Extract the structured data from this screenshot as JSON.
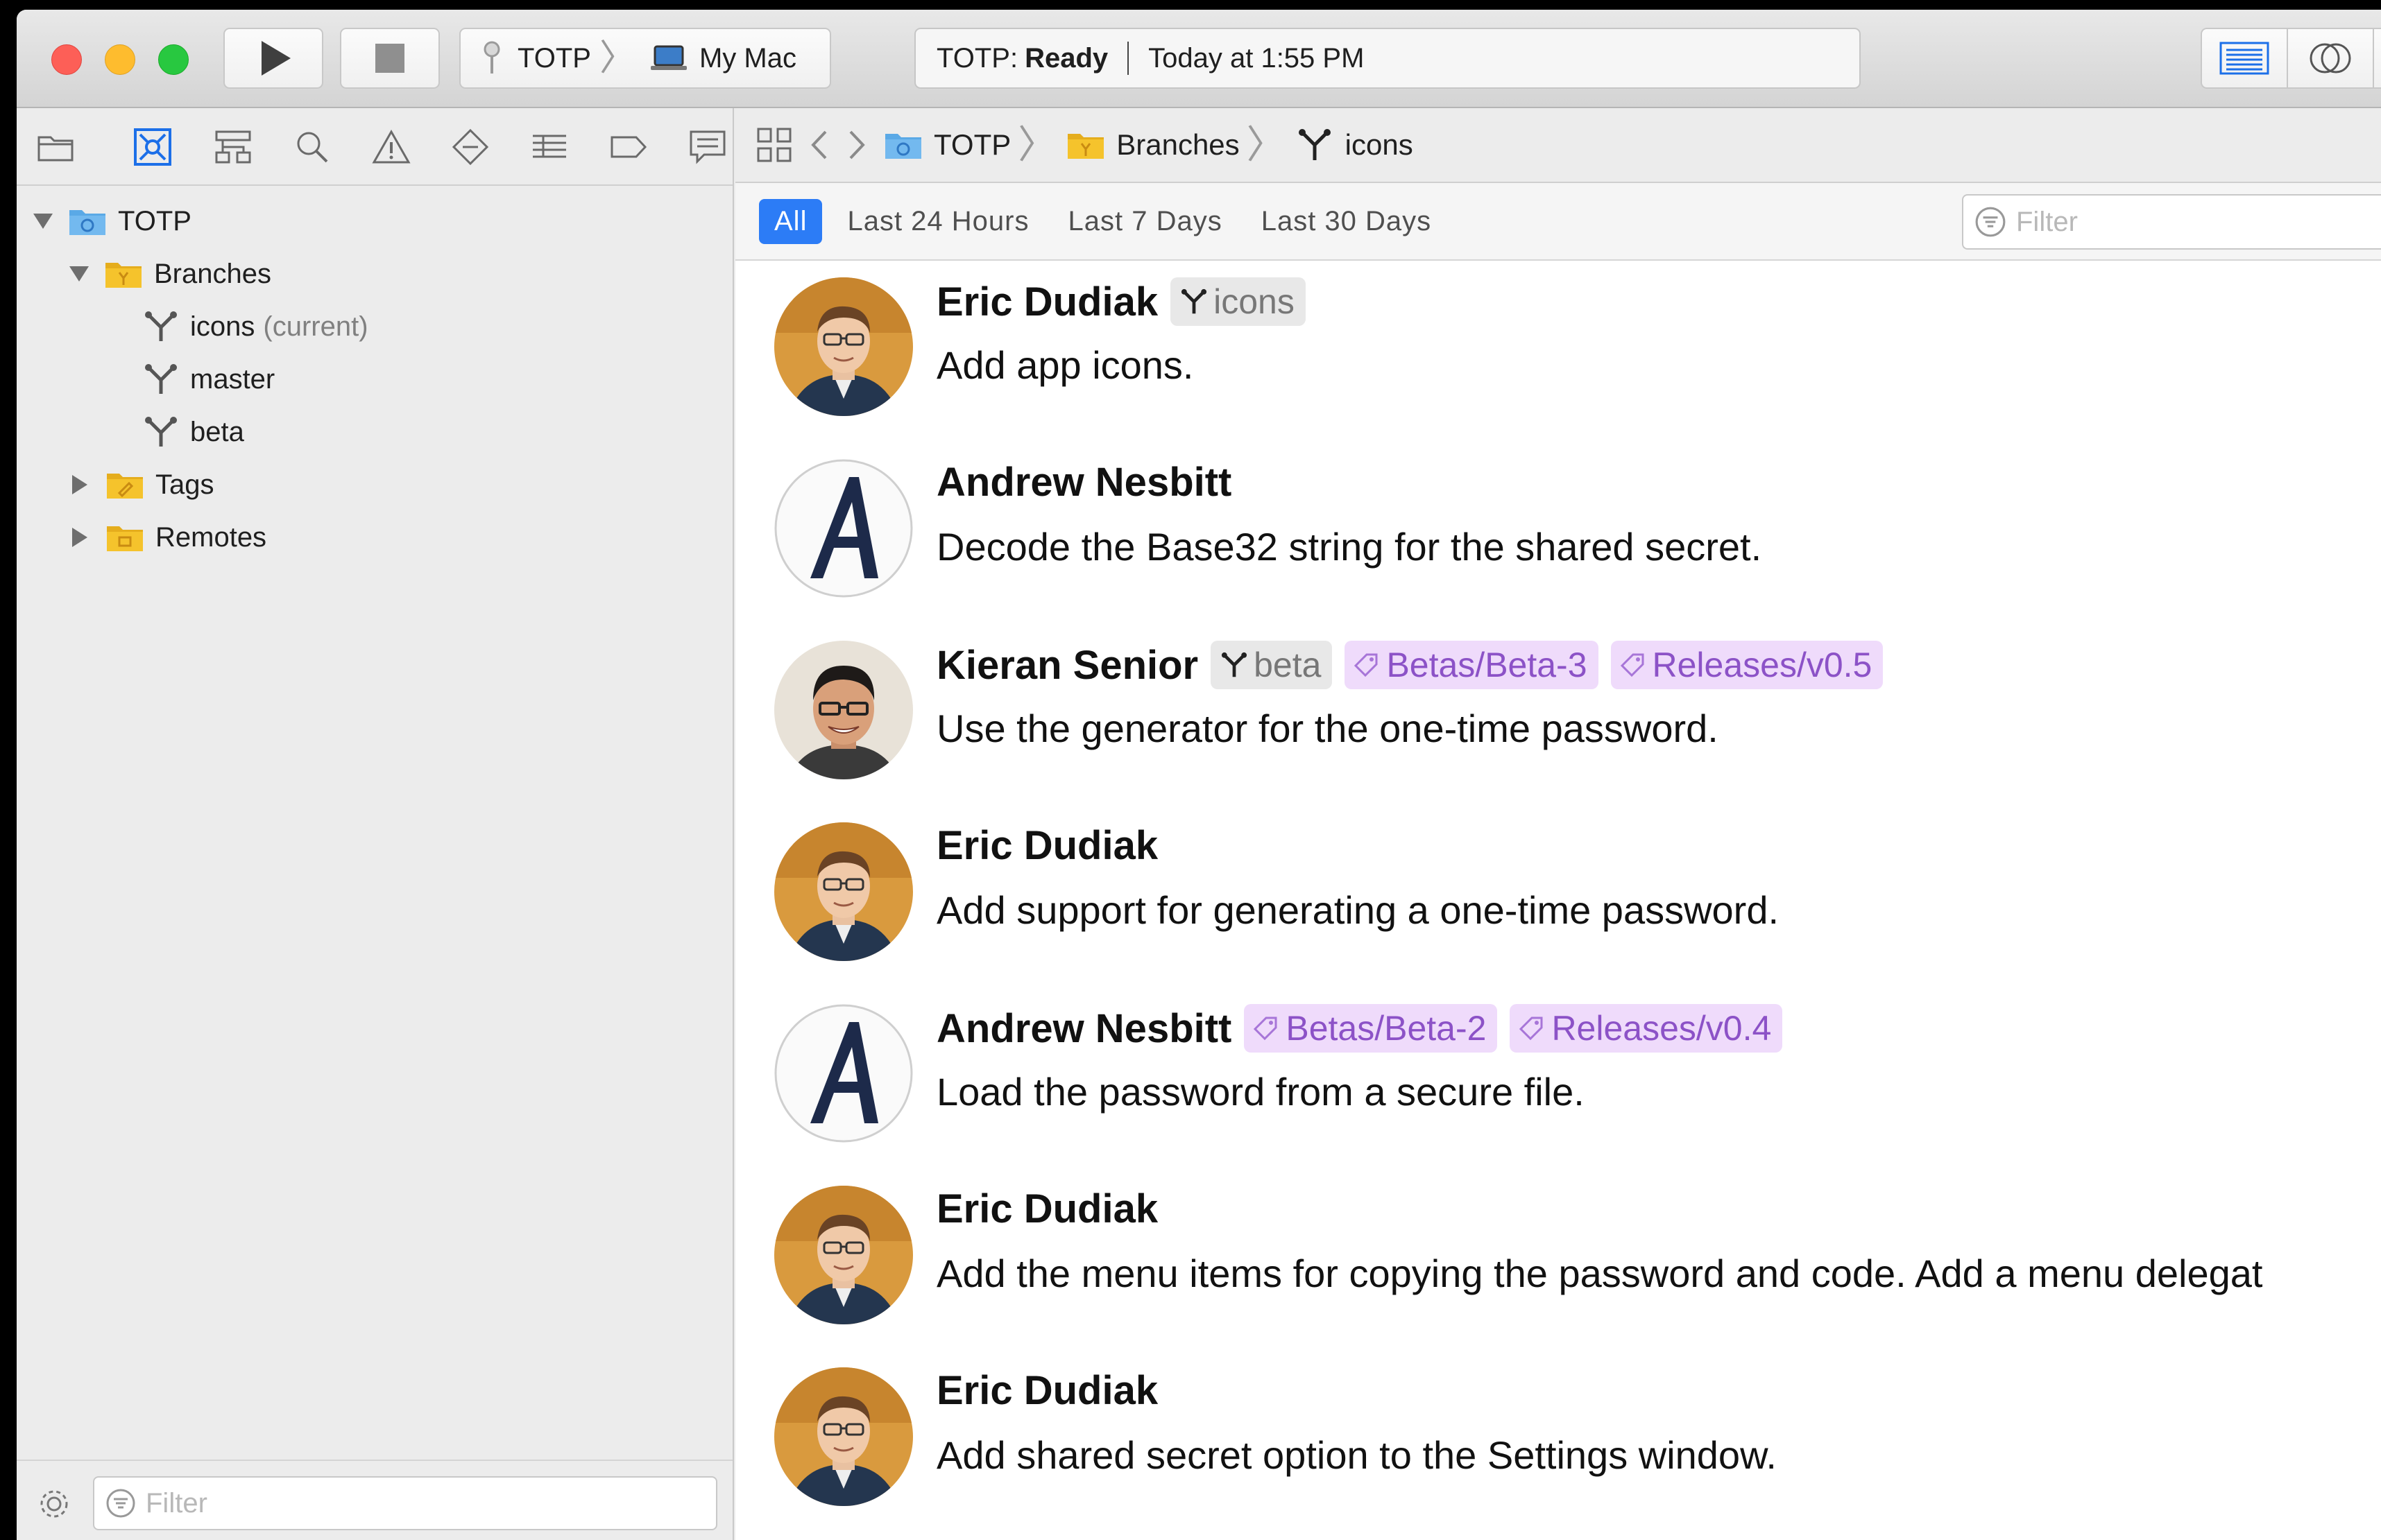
{
  "toolbar": {
    "scheme": {
      "project": "TOTP",
      "destination": "My Mac"
    },
    "activity": {
      "project": "TOTP:",
      "status": "Ready",
      "time": "Today at 1:55 PM"
    }
  },
  "navigator": {
    "tree": {
      "root": "TOTP",
      "branches_folder": "Branches",
      "branches": [
        {
          "name": "icons",
          "note": "(current)"
        },
        {
          "name": "master",
          "note": ""
        },
        {
          "name": "beta",
          "note": ""
        }
      ],
      "tags_folder": "Tags",
      "remotes_folder": "Remotes"
    },
    "filter_placeholder": "Filter"
  },
  "jumpbar": {
    "crumbs": [
      "TOTP",
      "Branches",
      "icons"
    ]
  },
  "scopebar": {
    "scopes": [
      "All",
      "Last 24 Hours",
      "Last 7 Days",
      "Last 30 Days"
    ],
    "active": "All",
    "filter_placeholder": "Filter"
  },
  "commits": [
    {
      "author": "Eric Dudiak",
      "avatar": "eric",
      "branch": "icons",
      "tags": [],
      "message": "Add app icons."
    },
    {
      "author": "Andrew Nesbitt",
      "avatar": "letter-a",
      "branch": "",
      "tags": [],
      "message": "Decode the Base32 string for the shared secret."
    },
    {
      "author": "Kieran Senior",
      "avatar": "kieran",
      "branch": "beta",
      "tags": [
        "Betas/Beta-3",
        "Releases/v0.5"
      ],
      "message": "Use the generator for the one-time password."
    },
    {
      "author": "Eric Dudiak",
      "avatar": "eric",
      "branch": "",
      "tags": [],
      "message": "Add support for generating a one-time password."
    },
    {
      "author": "Andrew Nesbitt",
      "avatar": "letter-a",
      "branch": "",
      "tags": [
        "Betas/Beta-2",
        "Releases/v0.4"
      ],
      "message": "Load the password from a secure file."
    },
    {
      "author": "Eric Dudiak",
      "avatar": "eric",
      "branch": "",
      "tags": [],
      "message": "Add the menu items for copying the password and code. Add a menu delegat"
    },
    {
      "author": "Eric Dudiak",
      "avatar": "eric",
      "branch": "",
      "tags": [],
      "message": "Add shared secret option to the Settings window."
    }
  ],
  "colors": {
    "accent": "#2c7cf6",
    "tag_bg": "#efdbfb",
    "tag_text": "#8c52c7",
    "branch_bg": "#e8e8e8",
    "folder_yellow": "#f5c32c",
    "project_blue": "#5aa9e6"
  }
}
